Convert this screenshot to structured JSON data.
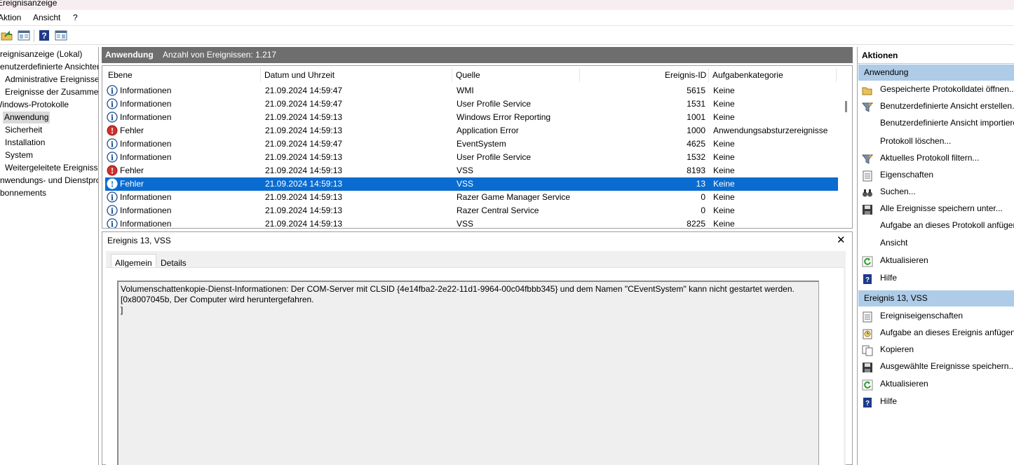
{
  "app": {
    "title": "Ereignisanzeige"
  },
  "menu": {
    "action": "Aktion",
    "view": "Ansicht",
    "help": "?"
  },
  "tree": {
    "items": [
      {
        "label": "Ereignisanzeige (Lokal)"
      },
      {
        "label": "Benutzerdefinierte Ansichten"
      },
      {
        "label": "Administrative Ereignisse"
      },
      {
        "label": "Ereignisse der Zusammenfassungsseite"
      },
      {
        "label": "Windows-Protokolle"
      },
      {
        "label": "Anwendung"
      },
      {
        "label": "Sicherheit"
      },
      {
        "label": "Installation"
      },
      {
        "label": "System"
      },
      {
        "label": "Weitergeleitete Ereignisse"
      },
      {
        "label": "Anwendungs- und Dienstprotokolle"
      },
      {
        "label": "Abonnements"
      }
    ]
  },
  "center": {
    "title": "Anwendung",
    "count": "Anzahl von Ereignissen: 1.217",
    "columns": [
      "Ebene",
      "Datum und Uhrzeit",
      "Quelle",
      "Ereignis-ID",
      "Aufgabenkategorie"
    ],
    "rows": [
      {
        "level": "Informationen",
        "type": "info",
        "date": "21.09.2024 14:59:47",
        "source": "WMI",
        "id": "5615",
        "category": "Keine"
      },
      {
        "level": "Informationen",
        "type": "info",
        "date": "21.09.2024 14:59:47",
        "source": "User Profile Service",
        "id": "1531",
        "category": "Keine"
      },
      {
        "level": "Informationen",
        "type": "info",
        "date": "21.09.2024 14:59:13",
        "source": "Windows Error Reporting",
        "id": "1001",
        "category": "Keine"
      },
      {
        "level": "Fehler",
        "type": "error",
        "date": "21.09.2024 14:59:13",
        "source": "Application Error",
        "id": "1000",
        "category": "Anwendungsabsturzereignisse"
      },
      {
        "level": "Informationen",
        "type": "info",
        "date": "21.09.2024 14:59:47",
        "source": "EventSystem",
        "id": "4625",
        "category": "Keine"
      },
      {
        "level": "Informationen",
        "type": "info",
        "date": "21.09.2024 14:59:13",
        "source": "User Profile Service",
        "id": "1532",
        "category": "Keine"
      },
      {
        "level": "Fehler",
        "type": "error",
        "date": "21.09.2024 14:59:13",
        "source": "VSS",
        "id": "8193",
        "category": "Keine"
      },
      {
        "level": "Fehler",
        "type": "error-sel",
        "date": "21.09.2024 14:59:13",
        "source": "VSS",
        "id": "13",
        "category": "Keine"
      },
      {
        "level": "Informationen",
        "type": "info",
        "date": "21.09.2024 14:59:13",
        "source": "Razer Game Manager Service",
        "id": "0",
        "category": "Keine"
      },
      {
        "level": "Informationen",
        "type": "info",
        "date": "21.09.2024 14:59:13",
        "source": "Razer Central Service",
        "id": "0",
        "category": "Keine"
      },
      {
        "level": "Informationen",
        "type": "info",
        "date": "21.09.2024 14:59:13",
        "source": "VSS",
        "id": "8225",
        "category": "Keine"
      }
    ]
  },
  "detail": {
    "title": "Ereignis 13, VSS",
    "close": "✕",
    "tabs": [
      "Allgemein",
      "Details"
    ],
    "message": [
      "Volumenschattenkopie-Dienst-Informationen: Der COM-Server mit CLSID {4e14fba2-2e22-11d1-9964-00c04fbbb345} und dem Namen \"CEventSystem\" kann nicht gestartet werden.",
      "[0x8007045b, Der Computer wird heruntergefahren.",
      "]"
    ]
  },
  "actions": {
    "header": "Aktionen",
    "section1": "Anwendung",
    "items1": [
      {
        "label": "Gespeicherte Protokolldatei öffnen...",
        "icon": "folder-open-icon"
      },
      {
        "label": "Benutzerdefinierte Ansicht erstellen...",
        "icon": "filter-icon"
      },
      {
        "label": "Benutzerdefinierte Ansicht importieren...",
        "icon": ""
      },
      {
        "label": "Protokoll löschen...",
        "icon": ""
      },
      {
        "label": "Aktuelles Protokoll filtern...",
        "icon": "filter-icon"
      },
      {
        "label": "Eigenschaften",
        "icon": "properties-icon"
      },
      {
        "label": "Suchen...",
        "icon": "binoculars-icon"
      },
      {
        "label": "Alle Ereignisse speichern unter...",
        "icon": "save-icon"
      },
      {
        "label": "Aufgabe an dieses Protokoll anfügen...",
        "icon": ""
      },
      {
        "label": "Ansicht",
        "icon": ""
      },
      {
        "label": "Aktualisieren",
        "icon": "refresh-icon"
      },
      {
        "label": "Hilfe",
        "icon": "help-icon"
      }
    ],
    "section2": "Ereignis 13, VSS",
    "items2": [
      {
        "label": "Ereigniseigenschaften",
        "icon": "properties-icon"
      },
      {
        "label": "Aufgabe an dieses Ereignis anfügen...",
        "icon": "task-icon"
      },
      {
        "label": "Kopieren",
        "icon": "copy-icon"
      },
      {
        "label": "Ausgewählte Ereignisse speichern...",
        "icon": "save-icon"
      },
      {
        "label": "Aktualisieren",
        "icon": "refresh-icon"
      },
      {
        "label": "Hilfe",
        "icon": "help-icon"
      }
    ]
  },
  "colors": {
    "selection": "#0a6cd0",
    "section": "#aecbe8",
    "header": "#6e6e6e",
    "error": "#d0312d",
    "info": "#1f4e8c"
  }
}
